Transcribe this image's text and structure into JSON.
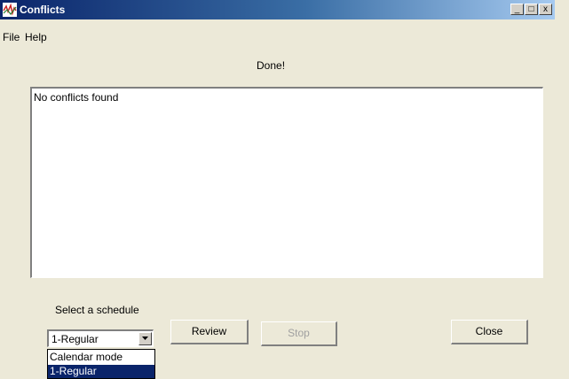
{
  "window": {
    "title": "Conflicts"
  },
  "titlebar_buttons": {
    "minimize": "_",
    "maximize": "□",
    "close": "x"
  },
  "menu": {
    "items": [
      "File",
      "Help"
    ]
  },
  "status": "Done!",
  "conflicts_list": {
    "items": [
      "No conflicts found"
    ]
  },
  "schedule": {
    "label": "Select a schedule",
    "selected": "1-Regular",
    "options": [
      "Calendar mode",
      "1-Regular"
    ]
  },
  "buttons": {
    "review": "Review",
    "stop": "Stop",
    "close": "Close"
  },
  "colors": {
    "title_bar": "#0a246a",
    "selection": "#0a246a",
    "face": "#ece9d8"
  }
}
